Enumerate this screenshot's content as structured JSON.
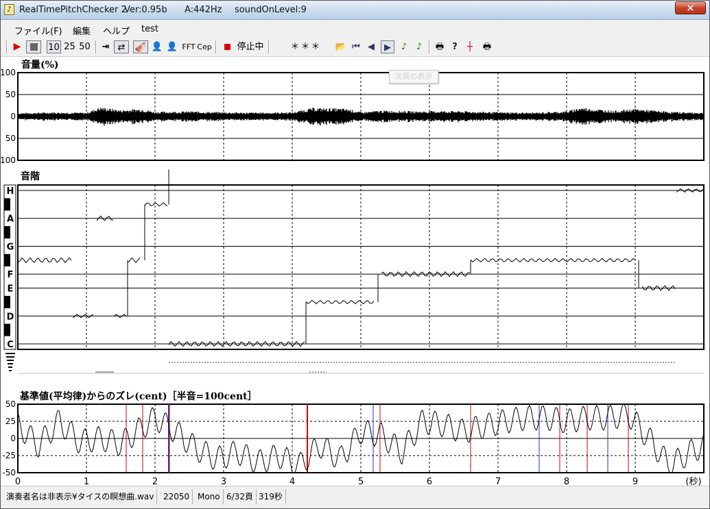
{
  "window": {
    "title_app": "RealTimePitchChecker 2",
    "title_ver": "Ver:0.95b",
    "title_a": "A:442Hz",
    "title_level": "soundOnLevel:9",
    "close_glyph": "✕"
  },
  "menu": [
    {
      "label": "ファイル(F)"
    },
    {
      "label": "編集"
    },
    {
      "label": "ヘルプ"
    },
    {
      "label": "test"
    }
  ],
  "toolbar": {
    "scale_10": "10",
    "scale_25": "25",
    "scale_50": "50",
    "fft_label": "FFT",
    "cep_label": "Cep",
    "status_label": "停止中",
    "status_value": "＊＊＊",
    "tooltip": "次頁の表示"
  },
  "volume": {
    "title": "音量(%)",
    "yticks": [
      "100",
      "50",
      "0",
      "50",
      "100"
    ]
  },
  "scale": {
    "title": "音階",
    "notes": [
      "H",
      "A",
      "G",
      "F",
      "E",
      "D",
      "C"
    ]
  },
  "deviation": {
    "title": "基準値(平均律)からのズレ(cent)［半音=100cent］",
    "yticks": [
      "50",
      "25",
      "0",
      "-25",
      "-50"
    ],
    "xticks": [
      "0",
      "1",
      "2",
      "3",
      "4",
      "5",
      "6",
      "7",
      "8",
      "9"
    ],
    "xunit": "(秒)"
  },
  "chart_data": [
    {
      "type": "area",
      "title": "音量(%)",
      "ylim": [
        -100,
        100
      ],
      "xlim": [
        0,
        10
      ],
      "x_seconds": [
        0,
        0.5,
        1.0,
        1.2,
        1.5,
        1.8,
        2.0,
        2.5,
        3.0,
        3.5,
        4.0,
        4.3,
        4.8,
        5.0,
        5.3,
        5.8,
        6.3,
        7.0,
        7.5,
        8.0,
        8.2,
        8.7,
        9.0,
        9.5,
        10.0
      ],
      "amplitude_percent": [
        8,
        10,
        9,
        22,
        15,
        18,
        11,
        12,
        10,
        9,
        10,
        20,
        18,
        10,
        14,
        12,
        13,
        10,
        9,
        12,
        21,
        13,
        18,
        11,
        9
      ]
    },
    {
      "type": "line",
      "title": "音階",
      "categories": [
        "C",
        "D",
        "E",
        "F",
        "G",
        "A",
        "H"
      ],
      "segments": [
        {
          "x": [
            0.0,
            0.8
          ],
          "note": "F#"
        },
        {
          "x": [
            0.8,
            1.1
          ],
          "note": "D"
        },
        {
          "x": [
            1.15,
            1.4
          ],
          "note": "A"
        },
        {
          "x": [
            1.4,
            1.6
          ],
          "note": "D"
        },
        {
          "x": [
            1.6,
            1.8
          ],
          "note": "F#"
        },
        {
          "x": [
            1.85,
            2.2
          ],
          "note": "A#"
        },
        {
          "x": [
            2.2,
            4.2
          ],
          "note": "C"
        },
        {
          "x": [
            4.2,
            5.2
          ],
          "note": "D#"
        },
        {
          "x": [
            5.3,
            6.6
          ],
          "note": "E#"
        },
        {
          "x": [
            6.6,
            9.0
          ],
          "note": "F#"
        },
        {
          "x": [
            9.1,
            9.6
          ],
          "note": "E"
        },
        {
          "x": [
            9.6,
            10.0
          ],
          "note": "H"
        }
      ]
    },
    {
      "type": "line",
      "title": "基準値(平均律)からのズレ(cent)［半音=100cent］",
      "xlabel": "(秒)",
      "xlim": [
        0,
        10
      ],
      "ylim": [
        -50,
        50
      ],
      "x": [
        0,
        0.3,
        0.6,
        0.9,
        1.2,
        1.5,
        1.8,
        2.0,
        2.3,
        2.6,
        2.9,
        3.2,
        3.5,
        3.8,
        4.1,
        4.4,
        4.7,
        5.0,
        5.3,
        5.6,
        5.9,
        6.2,
        6.5,
        6.8,
        7.1,
        7.4,
        7.7,
        8.0,
        8.3,
        8.6,
        8.9,
        9.2,
        9.5,
        9.8,
        10.0
      ],
      "y_cent": [
        20,
        -10,
        25,
        -5,
        0,
        -8,
        15,
        30,
        10,
        -15,
        -30,
        -20,
        -35,
        -25,
        -40,
        -10,
        -30,
        10,
        5,
        -20,
        25,
        20,
        10,
        18,
        25,
        30,
        30,
        25,
        30,
        30,
        35,
        0,
        -40,
        -20,
        -10
      ]
    }
  ]
}
